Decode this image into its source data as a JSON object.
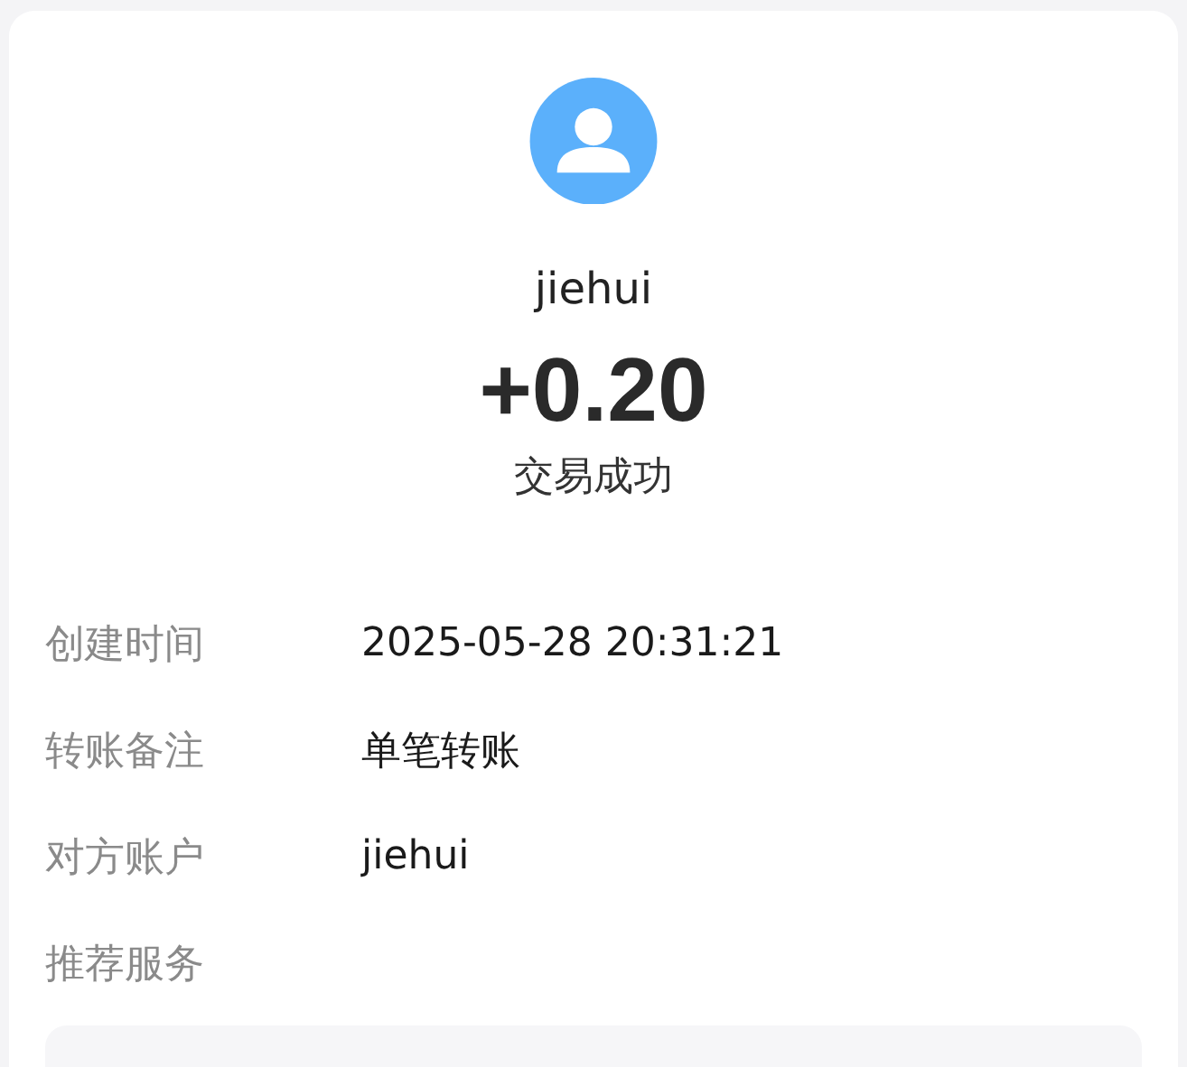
{
  "payee": {
    "name": "jiehui"
  },
  "amount": "+0.20",
  "status": "交易成功",
  "details": [
    {
      "label": "创建时间",
      "value": "2025-05-28 20:31:21"
    },
    {
      "label": "转账备注",
      "value": "单笔转账"
    },
    {
      "label": "对方账户",
      "value": "jiehui"
    },
    {
      "label": "推荐服务"
    }
  ]
}
